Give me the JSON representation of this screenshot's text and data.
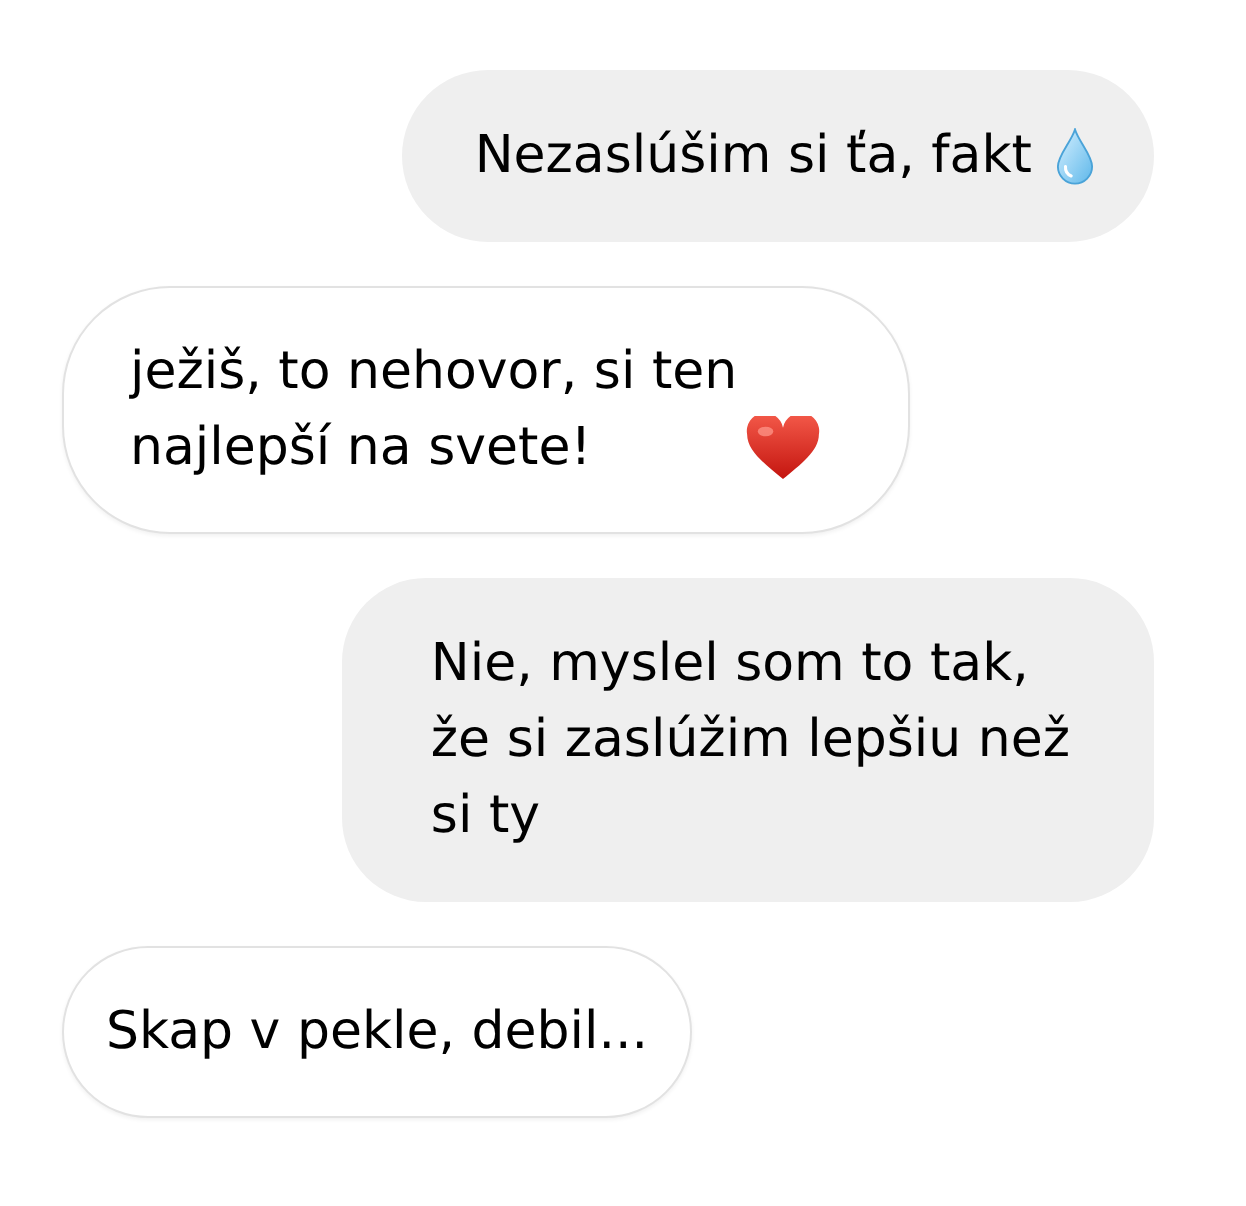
{
  "messages": [
    {
      "kind": "outgoing",
      "text": "Nezaslúšim si ťa, fakt",
      "emoji": {
        "kind": "droplet"
      }
    },
    {
      "kind": "incoming",
      "text": "ježiš, to nehovor, si ten\nnajlepší na svete!",
      "emoji": {
        "kind": "heart"
      }
    },
    {
      "kind": "outgoing",
      "text": "Nie, myslel som to tak,\nže si zaslúžim lepšiu než\nsi ty"
    },
    {
      "kind": "incoming",
      "text": "Skap v pekle, debil..."
    }
  ]
}
